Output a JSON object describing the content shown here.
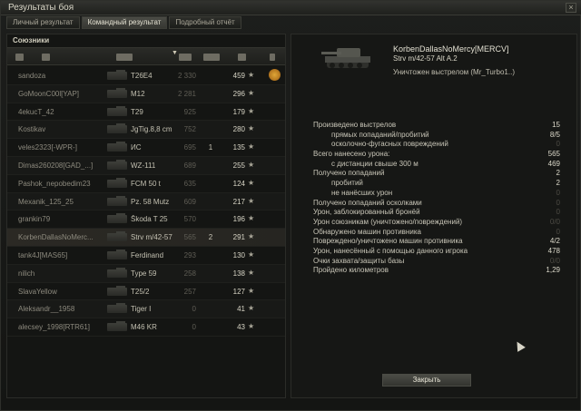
{
  "window": {
    "title": "Результаты боя",
    "close_glyph": "×"
  },
  "tabs": [
    {
      "label": "Личный результат",
      "active": false
    },
    {
      "label": "Командный результат",
      "active": true
    },
    {
      "label": "Подробный отчёт",
      "active": false
    }
  ],
  "team": {
    "heading": "Союзники",
    "header_icons": [
      "platoon-icon",
      "player-icon",
      "tank-class-icon",
      "sort-desc-icon",
      "damage-icon",
      "frag-icon",
      "xp-icon",
      "medal-icon"
    ],
    "rows": [
      {
        "player": "sandoza",
        "tank": "T26E4",
        "damage": "2 330",
        "kills": "",
        "xp": "459",
        "medal": true
      },
      {
        "player": "GoMoonC00l[YAP]",
        "tank": "M12",
        "damage": "2 281",
        "kills": "",
        "xp": "296"
      },
      {
        "player": "4ekucT_42",
        "tank": "T29",
        "damage": "925",
        "kills": "",
        "xp": "179"
      },
      {
        "player": "Kostikav",
        "tank": "JgTig.8,8 cm",
        "damage": "752",
        "kills": "",
        "xp": "280"
      },
      {
        "player": "veles2323[-WPR-]",
        "tank": "ИС",
        "damage": "695",
        "kills": "1",
        "xp": "135"
      },
      {
        "player": "Dimas260208[GAD_...]",
        "tank": "WZ-111",
        "damage": "689",
        "kills": "",
        "xp": "255"
      },
      {
        "player": "Pashok_nepobedim23",
        "tank": "FCM 50 t",
        "damage": "635",
        "kills": "",
        "xp": "124"
      },
      {
        "player": "Mexanik_125_25",
        "tank": "Pz. 58 Mutz",
        "damage": "609",
        "kills": "",
        "xp": "217"
      },
      {
        "player": "grankin79",
        "tank": "Škoda T 25",
        "damage": "570",
        "kills": "",
        "xp": "196"
      },
      {
        "player": "KorbenDallasNoMerc...",
        "tank": "Strv m/42-57",
        "damage": "565",
        "kills": "2",
        "xp": "291",
        "self": true
      },
      {
        "player": "tank4J[MAS65]",
        "tank": "Ferdinand",
        "damage": "293",
        "kills": "",
        "xp": "130"
      },
      {
        "player": "nilich",
        "tank": "Type 59",
        "damage": "258",
        "kills": "",
        "xp": "138"
      },
      {
        "player": "SlavaYellow",
        "tank": "T25/2",
        "damage": "257",
        "kills": "",
        "xp": "127"
      },
      {
        "player": "Aleksandr__1958",
        "tank": "Tiger I",
        "damage": "0",
        "kills": "",
        "xp": "41"
      },
      {
        "player": "alecsey_1998[RTR61]",
        "tank": "M46 KR",
        "damage": "0",
        "kills": "",
        "xp": "43"
      }
    ],
    "star_glyph": "★"
  },
  "detail": {
    "player": "KorbenDallasNoMercy[MERCV]",
    "tank": "Strv m/42-57 Alt A.2",
    "fate": "Уничтожен выстрелом (Mr_Turbo1..)",
    "stats": [
      {
        "label": "Произведено выстрелов",
        "value": "15",
        "sub": false
      },
      {
        "label": "прямых попаданий/пробитий",
        "value": "8/5",
        "sub": true
      },
      {
        "label": "осколочно-фугасных повреждений",
        "value": "0",
        "sub": true
      },
      {
        "label": "Всего нанесено урона:",
        "value": "565",
        "sub": false
      },
      {
        "label": "с дистанции свыше 300 м",
        "value": "469",
        "sub": true
      },
      {
        "label": "Получено попаданий",
        "value": "2",
        "sub": false
      },
      {
        "label": "пробитий",
        "value": "2",
        "sub": true
      },
      {
        "label": "не нанёсших урон",
        "value": "0",
        "sub": true
      },
      {
        "label": "Получено попаданий осколками",
        "value": "0",
        "sub": false
      },
      {
        "label": "Урон, заблокированный бронёй",
        "value": "0",
        "sub": false
      },
      {
        "label": "Урон союзникам (уничтожено/повреждений)",
        "value": "0/0",
        "sub": false
      },
      {
        "label": "Обнаружено машин противника",
        "value": "0",
        "sub": false
      },
      {
        "label": "Повреждено/уничтожено машин противника",
        "value": "4/2",
        "sub": false
      },
      {
        "label": "Урон, нанесённый с помощью данного игрока",
        "value": "478",
        "sub": false
      },
      {
        "label": "Очки захвата/защиты базы",
        "value": "0/0",
        "sub": false
      },
      {
        "label": "Пройдено километров",
        "value": "1,29",
        "sub": false
      }
    ],
    "close_label": "Закрыть"
  }
}
